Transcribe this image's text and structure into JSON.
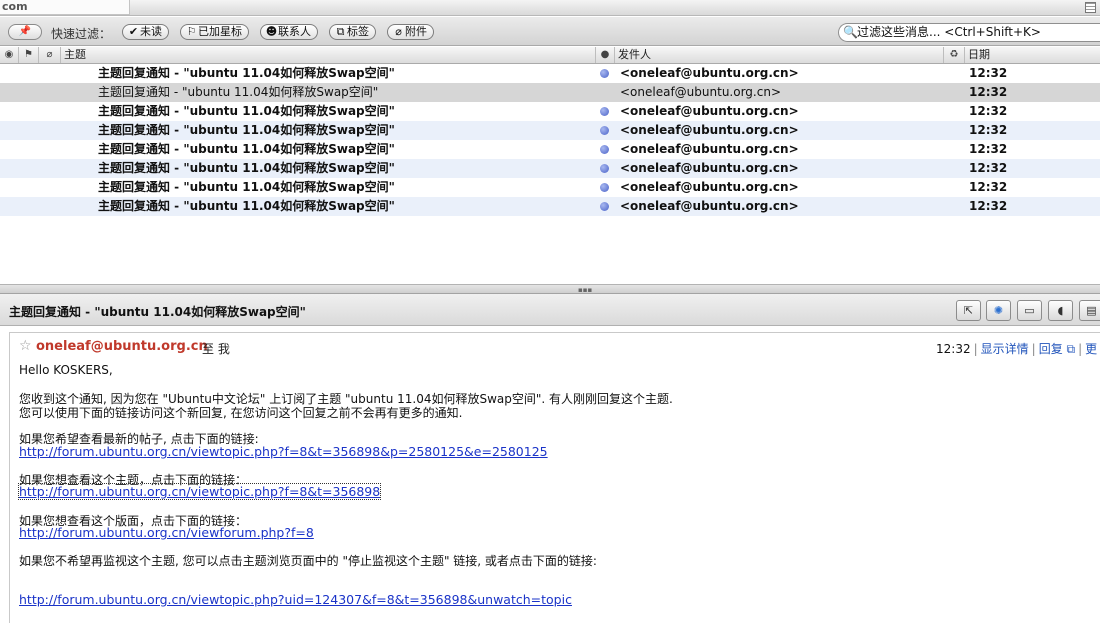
{
  "top_strip": {
    "url_fragment": "com"
  },
  "filter_bar": {
    "pin_icon": "pin-icon",
    "label": "快速过滤：",
    "buttons": [
      {
        "icon": "✔",
        "label": "未读"
      },
      {
        "icon": "⚐",
        "label": "已加星标"
      },
      {
        "icon": "☻",
        "label": "联系人"
      },
      {
        "icon": "⧉",
        "label": "标签"
      },
      {
        "icon": "⌀",
        "label": "附件"
      }
    ],
    "search_placeholder": "过滤这些消息... <Ctrl+Shift+K>"
  },
  "columns": {
    "subject": "主题",
    "sender": "发件人",
    "date": "日期"
  },
  "messages": [
    {
      "subject": "主题回复通知 - \"ubuntu 11.04如何释放Swap空间\"",
      "sender": "<oneleaf@ubuntu.org.cn>",
      "date": "12:32",
      "unread": true,
      "selected": false
    },
    {
      "subject": "主题回复通知 - \"ubuntu 11.04如何释放Swap空间\"",
      "sender": "<oneleaf@ubuntu.org.cn>",
      "date": "12:32",
      "unread": false,
      "selected": true
    },
    {
      "subject": "主题回复通知 - \"ubuntu 11.04如何释放Swap空间\"",
      "sender": "<oneleaf@ubuntu.org.cn>",
      "date": "12:32",
      "unread": true,
      "selected": false
    },
    {
      "subject": "主题回复通知 - \"ubuntu 11.04如何释放Swap空间\"",
      "sender": "<oneleaf@ubuntu.org.cn>",
      "date": "12:32",
      "unread": true,
      "selected": false
    },
    {
      "subject": "主题回复通知 - \"ubuntu 11.04如何释放Swap空间\"",
      "sender": "<oneleaf@ubuntu.org.cn>",
      "date": "12:32",
      "unread": true,
      "selected": false
    },
    {
      "subject": "主题回复通知 - \"ubuntu 11.04如何释放Swap空间\"",
      "sender": "<oneleaf@ubuntu.org.cn>",
      "date": "12:32",
      "unread": true,
      "selected": false
    },
    {
      "subject": "主题回复通知 - \"ubuntu 11.04如何释放Swap空间\"",
      "sender": "<oneleaf@ubuntu.org.cn>",
      "date": "12:32",
      "unread": true,
      "selected": false
    },
    {
      "subject": "主题回复通知 - \"ubuntu 11.04如何释放Swap空间\"",
      "sender": "<oneleaf@ubuntu.org.cn>",
      "date": "12:32",
      "unread": true,
      "selected": false
    }
  ],
  "message": {
    "title": "主题回复通知 - \"ubuntu 11.04如何释放Swap空间\"",
    "sender": "oneleaf@ubuntu.org.cn",
    "to": "至 我",
    "time": "12:32",
    "show_details": "显示详情",
    "reply": "回复",
    "more_fragment": "更",
    "greeting": "Hello KOSKERS,",
    "para1_line1": "您收到这个通知, 因为您在 \"Ubuntu中文论坛\" 上订阅了主题 \"ubuntu 11.04如何释放Swap空间\". 有人刚刚回复这个主题.",
    "para1_line2": "您可以使用下面的链接访问这个新回复, 在您访问这个回复之前不会再有更多的通知.",
    "newest_label": "如果您希望查看最新的帖子, 点击下面的链接:",
    "newest_link": "http://forum.ubuntu.org.cn/viewtopic.php?f=8&t=356898&p=2580125&e=2580125",
    "topic_label": "如果您想查看这个主题，点击下面的链接：",
    "topic_link": "http://forum.ubuntu.org.cn/viewtopic.php?f=8&t=356898",
    "forum_label": "如果您想查看这个版面，点击下面的链接：",
    "forum_link": "http://forum.ubuntu.org.cn/viewforum.php?f=8",
    "unwatch_label": "如果您不希望再监视这个主题, 您可以点击主题浏览页面中的 \"停止监视这个主题\" 链接, 或者点击下面的链接:",
    "unwatch_link": "http://forum.ubuntu.org.cn/viewtopic.php?uid=124307&f=8&t=356898&unwatch=topic"
  }
}
